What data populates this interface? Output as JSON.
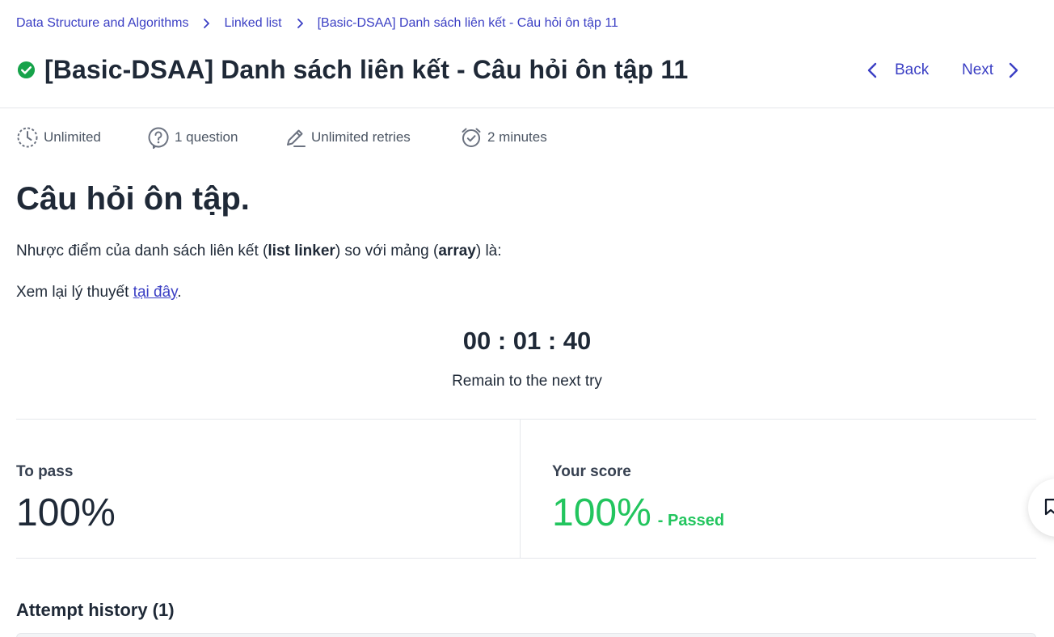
{
  "breadcrumb": {
    "items": [
      {
        "label": "Data Structure and Algorithms"
      },
      {
        "label": "Linked list"
      },
      {
        "label": "[Basic-DSAA] Danh sách liên kết - Câu hỏi ôn tập 11"
      }
    ],
    "separator_icon": "chevron-right-icon"
  },
  "header": {
    "status_icon": "check-circle-icon",
    "status_color": "#16a34a",
    "title": "[Basic-DSAA] Danh sách liên kết - Câu hỏi ôn tập 11",
    "back_label": "Back",
    "next_label": "Next"
  },
  "meta": {
    "items": [
      {
        "icon": "clock-dashed-icon",
        "label": "Unlimited"
      },
      {
        "icon": "question-circle-icon",
        "label": "1 question"
      },
      {
        "icon": "pencil-icon",
        "label": "Unlimited retries"
      },
      {
        "icon": "alarm-clock-icon",
        "label": "2 minutes"
      }
    ]
  },
  "question": {
    "heading": "Câu hỏi ôn tập.",
    "text_part1": "Nhược điểm của danh sách liên kết (",
    "text_bold1": "list linker",
    "text_part2": ") so với mảng (",
    "text_bold2": "array",
    "text_part3": ") là:",
    "review_prefix": "Xem lại lý thuyết ",
    "review_link": "tại đây",
    "review_suffix": "."
  },
  "timer": {
    "value": "00 : 01 : 40",
    "caption": "Remain to the next try"
  },
  "scores": {
    "to_pass_label": "To pass",
    "to_pass_value": "100%",
    "your_score_label": "Your score",
    "your_score_value": "100%",
    "your_score_status": "- Passed",
    "passed_color": "#22c55e"
  },
  "history": {
    "title": "Attempt history (1)"
  },
  "colors": {
    "accent": "#3b3fc4",
    "text": "#1f2937",
    "border": "#e5e7eb"
  }
}
